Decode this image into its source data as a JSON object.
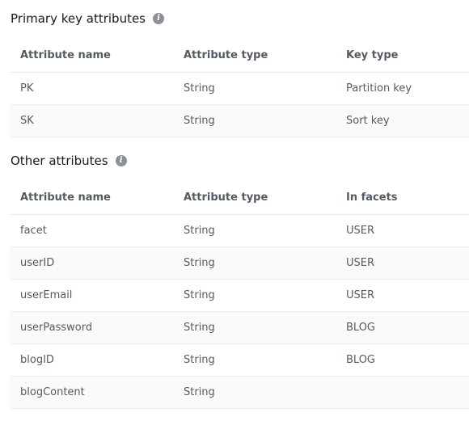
{
  "primary": {
    "title": "Primary key attributes",
    "info_icon": "info-icon",
    "headers": [
      "Attribute name",
      "Attribute type",
      "Key type"
    ],
    "rows": [
      [
        "PK",
        "String",
        "Partition key"
      ],
      [
        "SK",
        "String",
        "Sort key"
      ]
    ]
  },
  "other": {
    "title": "Other attributes",
    "info_icon": "info-icon",
    "headers": [
      "Attribute name",
      "Attribute type",
      "In facets"
    ],
    "rows": [
      [
        "facet",
        "String",
        "USER"
      ],
      [
        "userID",
        "String",
        "USER"
      ],
      [
        "userEmail",
        "String",
        "USER"
      ],
      [
        "userPassword",
        "String",
        "BLOG"
      ],
      [
        "blogID",
        "String",
        "BLOG"
      ],
      [
        "blogContent",
        "String",
        ""
      ]
    ]
  }
}
